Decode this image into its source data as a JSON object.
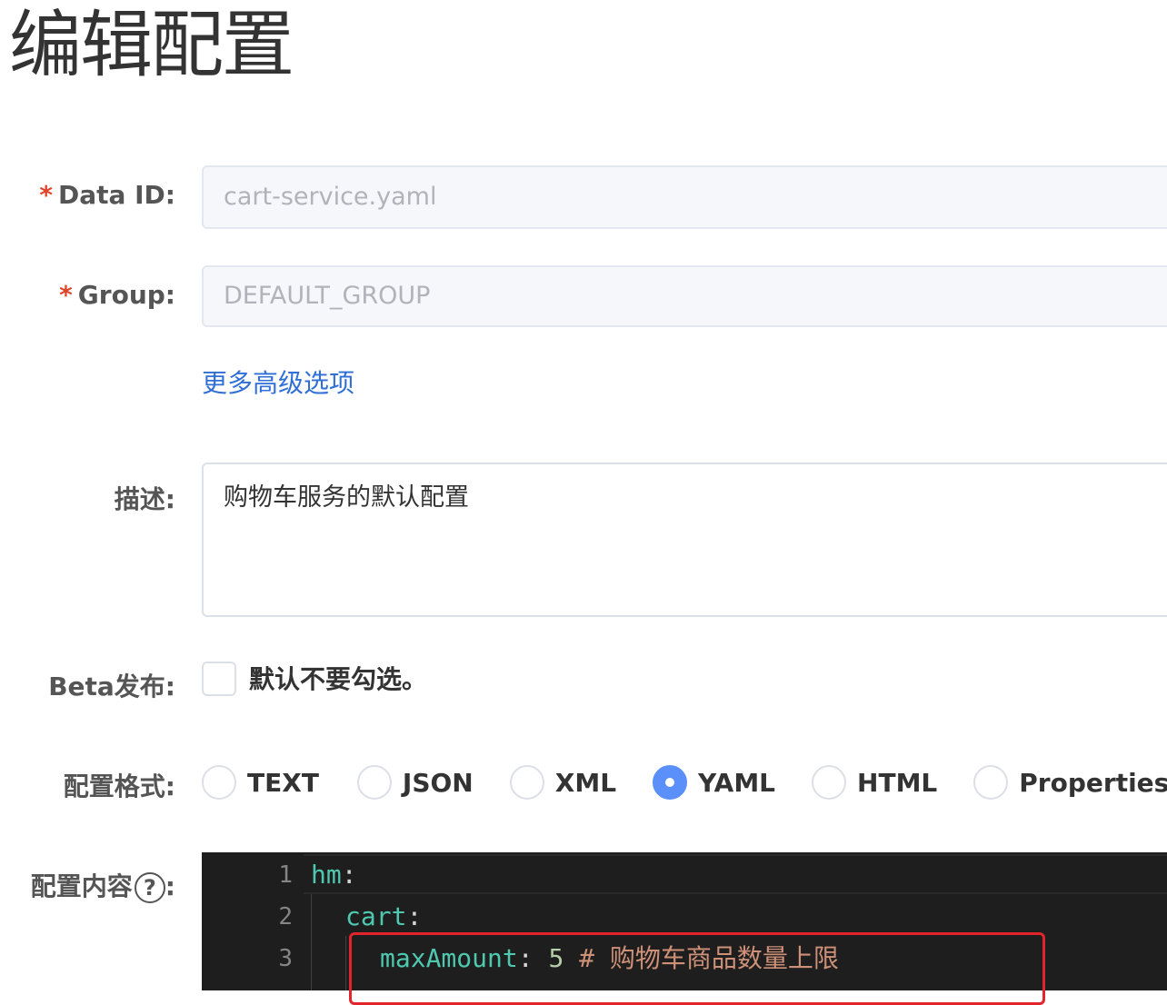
{
  "page": {
    "title": "编辑配置"
  },
  "fields": {
    "data_id": {
      "label": "Data ID:",
      "value": "cart-service.yaml"
    },
    "group": {
      "label": "Group:",
      "value": "DEFAULT_GROUP"
    },
    "advanced_link": "更多高级选项",
    "description": {
      "label": "描述:",
      "value": "购物车服务的默认配置"
    },
    "beta": {
      "label": "Beta发布:",
      "hint": "默认不要勾选。"
    },
    "format": {
      "label": "配置格式:",
      "options": [
        "TEXT",
        "JSON",
        "XML",
        "YAML",
        "HTML",
        "Properties"
      ],
      "selected": "YAML"
    },
    "content": {
      "label": "配置内容",
      "help_glyph": "?"
    }
  },
  "editor": {
    "lines": [
      {
        "no": "1",
        "key": "hm",
        "sep": ":",
        "value": "",
        "comment": ""
      },
      {
        "no": "2",
        "key": "cart",
        "sep": ":",
        "value": "",
        "comment": ""
      },
      {
        "no": "3",
        "key": "maxAmount",
        "sep": ": ",
        "value": "5",
        "comment": " # 购物车商品数量上限"
      }
    ]
  },
  "colors": {
    "required_star": "#e0452b",
    "link": "#2f6fd6",
    "radio_selected": "#5b8ff9",
    "highlight_box": "#e3242b",
    "editor_bg": "#1e1e1e"
  },
  "required_mark": "*",
  "colon": ":"
}
